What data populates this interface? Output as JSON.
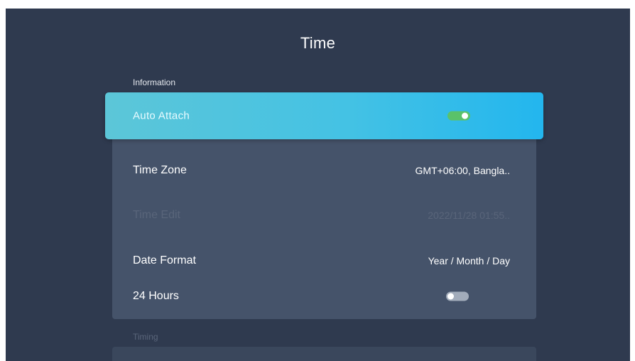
{
  "header": {
    "title": "Time"
  },
  "sections": {
    "information": "Information",
    "timing": "Timing"
  },
  "rows": {
    "auto_attach": {
      "label": "Auto Attach",
      "toggle": "on"
    },
    "time_zone": {
      "label": "Time Zone",
      "value": "GMT+06:00, Bangla.."
    },
    "time_edit": {
      "label": "Time Edit",
      "value": "2022/11/28 01:55.."
    },
    "date_format": {
      "label": "Date Format",
      "value": "Year / Month / Day"
    },
    "hours_24": {
      "label": "24 Hours",
      "toggle": "off"
    }
  },
  "colors": {
    "background": "#2f3a4f",
    "panel": "#45536a",
    "focus_gradient_start": "#5cc6d8",
    "focus_gradient_end": "#23b6ee",
    "toggle_on": "#5ac26a",
    "toggle_off": "#a2acbb"
  }
}
